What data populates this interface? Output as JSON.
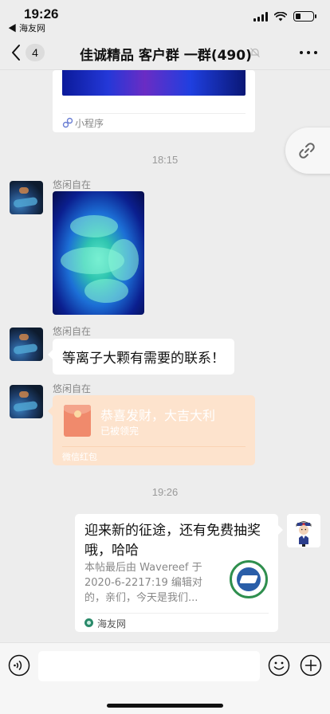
{
  "status_bar": {
    "time": "19:26",
    "back_to_app": "◀ 海友网",
    "battery_level": 0.3
  },
  "nav": {
    "unread_count": "4",
    "title": "佳诚精品 客户群 一群(490)"
  },
  "messages": {
    "mini_program": {
      "label": "小程序"
    },
    "timestamp_1": "18:15",
    "image_sender": "悠闲自在",
    "text_sender": "悠闲自在",
    "text_message": "等离子大颗有需要的联系！",
    "redpacket_sender": "悠闲自在",
    "red_packet": {
      "title": "恭喜发财，大吉大利",
      "status": "已被领完",
      "footer": "微信红包"
    },
    "timestamp_2": "19:26",
    "link_card": {
      "title": "迎来新的征途，还有免费抽奖哦，哈哈",
      "description": "本帖最后由 Wavereef 于 2020-6-2217:19 编辑对的，亲们，今天是我们...",
      "source": "海友网"
    }
  },
  "icons": {
    "back": "chevron-left-icon",
    "mute": "mute-bell-icon",
    "more": "more-dots-icon",
    "link": "link-icon",
    "voice": "voice-icon",
    "emoji": "emoji-icon",
    "add": "plus-icon"
  }
}
